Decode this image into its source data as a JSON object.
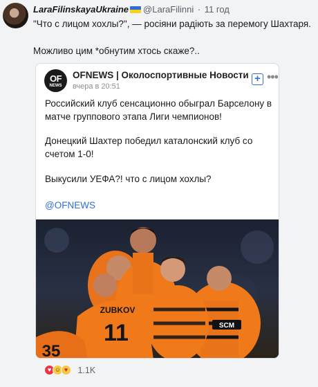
{
  "post": {
    "author": "LaraFilinskayaUkraine",
    "handle": "@LaraFilinni",
    "separator": "·",
    "time": "11 год",
    "text_line1": "\"Что с лицом хохлы?\", — росіяни радіють за перемогу Шахтаря.",
    "text_line2": "Можливо цим *обнутим хтось скаже?.."
  },
  "card": {
    "logo_line1": "OF",
    "logo_line2": "NEWS",
    "source_name": "OFNEWS | Околоспортивные Новости",
    "source_time": "вчера в 20:51",
    "add_label": "+",
    "more_label": "•••",
    "paragraph1": "Российский клуб сенсационно обыграл Барселону в матче группового этапа Лиги чемпионов!",
    "paragraph2": "Донецкий Шахтер победил каталонский клуб со счетом 1-0!",
    "paragraph3": "Выкусили УЕФА?! что с лицом хохлы?",
    "link": "@OFNEWS",
    "photo_jersey_name": "ZUBKOV",
    "photo_jersey_number": "11",
    "photo_jersey_number2": "35",
    "photo_sponsor": "SCM"
  },
  "reactions": {
    "icons": [
      "heart-reaction",
      "laugh-reaction",
      "love-reaction"
    ],
    "glyph_heart": "♥",
    "glyph_laugh": "☺",
    "glyph_love": "♥",
    "count": "1.1K"
  },
  "colors": {
    "accent": "#2f6fd6",
    "jersey_orange": "#f07a1a",
    "heart": "#e8344a"
  }
}
